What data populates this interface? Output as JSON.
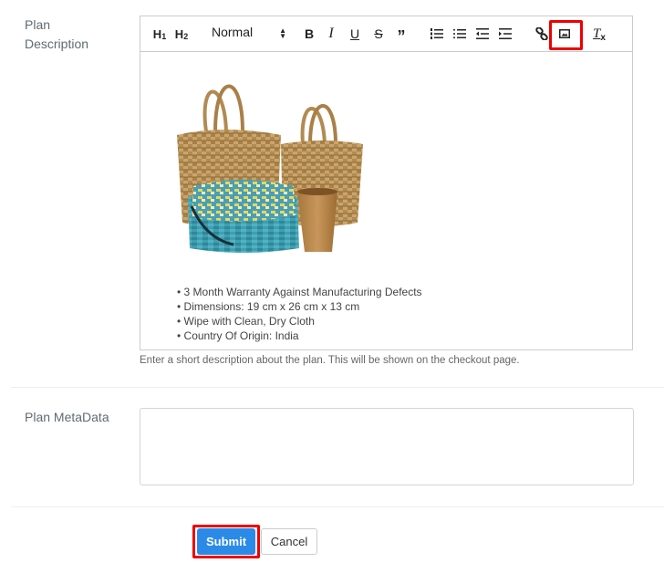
{
  "plan_description": {
    "label_line1": "Plan",
    "label_line2": "Description",
    "toolbar": {
      "h1": "H1",
      "h2": "H2",
      "format_select": "Normal",
      "icons": [
        "bold-icon",
        "italic-icon",
        "underline-icon",
        "strike-icon",
        "blockquote-icon",
        "ordered-list-icon",
        "bullet-list-icon",
        "outdent-icon",
        "indent-icon",
        "link-icon",
        "image-icon",
        "clear-format-icon"
      ],
      "highlighted": "image-icon"
    },
    "image_alt": "Woven baskets, teal pouch and wooden cup",
    "bullets": [
      "• 3 Month Warranty Against Manufacturing Defects",
      "• Dimensions: 19 cm x 26 cm x 13 cm",
      "• Wipe with Clean, Dry Cloth",
      "• Country Of Origin: India"
    ],
    "hint": "Enter a short description about the plan. This will be shown on the checkout page."
  },
  "plan_metadata": {
    "label": "Plan MetaData",
    "value": ""
  },
  "actions": {
    "submit": "Submit",
    "cancel": "Cancel",
    "highlighted": "submit"
  },
  "colors": {
    "primary": "#2b8ae8",
    "highlight": "#e00000"
  }
}
